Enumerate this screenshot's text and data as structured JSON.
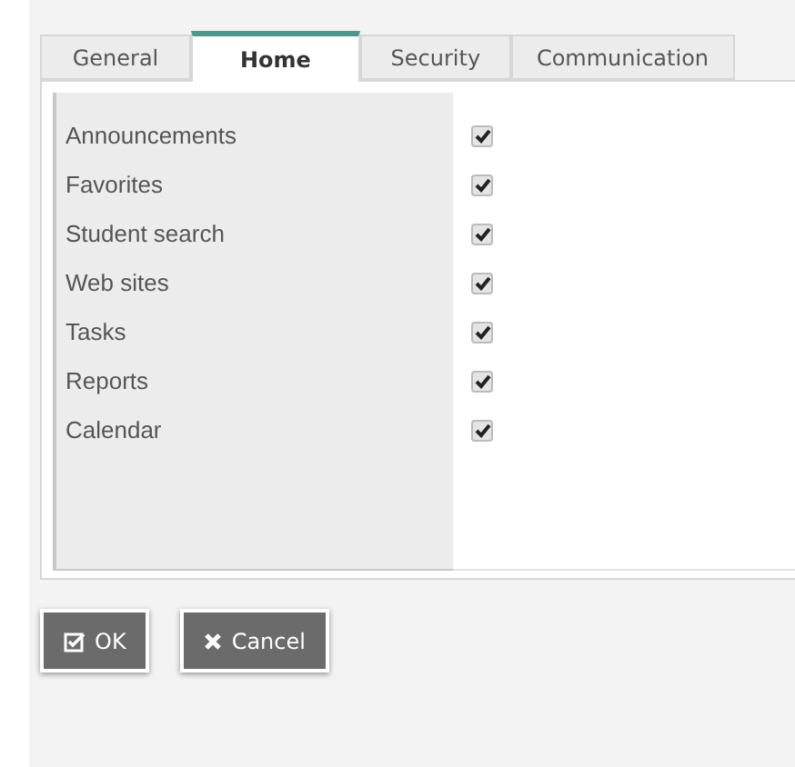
{
  "tabs": [
    {
      "label": "General",
      "selected": false
    },
    {
      "label": "Home",
      "selected": true
    },
    {
      "label": "Security",
      "selected": false
    },
    {
      "label": "Communication",
      "selected": false
    }
  ],
  "options": [
    {
      "label": "Announcements",
      "checked": true
    },
    {
      "label": "Favorites",
      "checked": true
    },
    {
      "label": "Student search",
      "checked": true
    },
    {
      "label": "Web sites",
      "checked": true
    },
    {
      "label": "Tasks",
      "checked": true
    },
    {
      "label": "Reports",
      "checked": true
    },
    {
      "label": "Calendar",
      "checked": true
    }
  ],
  "buttons": [
    {
      "kind": "ok",
      "label": "OK"
    },
    {
      "kind": "cancel",
      "label": "Cancel"
    }
  ]
}
